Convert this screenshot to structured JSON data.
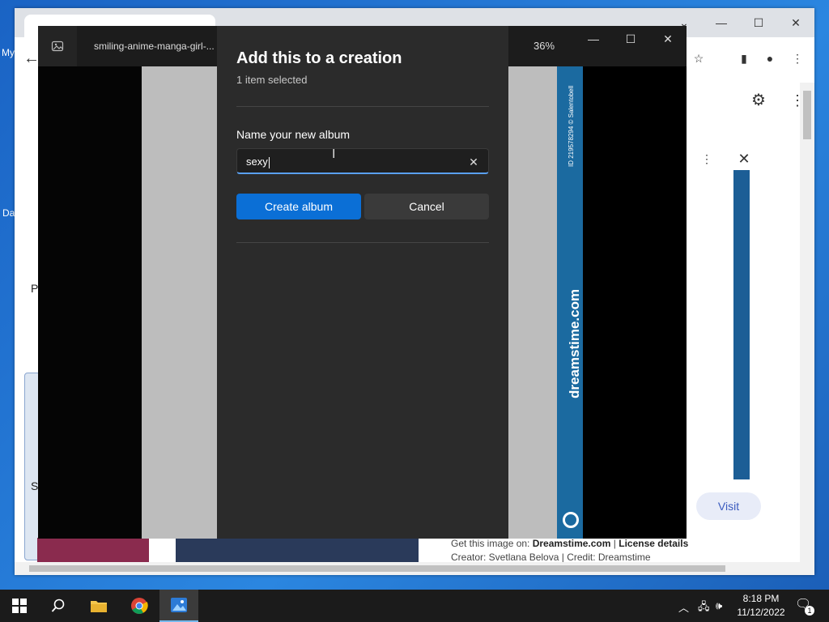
{
  "desktop": {
    "label_my": "My",
    "label_da": "Da"
  },
  "browser": {
    "left_text_p": "P",
    "left_text_s": "S",
    "credit_line1_prefix": "Get this image on: ",
    "credit_site": "Dreamstime.com",
    "credit_sep": " | ",
    "credit_license": "License details",
    "credit_line2": "Creator: Svetlana Belova | Credit: Dreamstime",
    "visit_label": "Visit"
  },
  "photos_app": {
    "file_title": "smiling-anime-manga-girl-...",
    "zoom_level": "36%",
    "strip_text": "dreamstime.com",
    "strip_id": "ID 219578294 © Salentobell"
  },
  "dialog": {
    "title": "Add this to a creation",
    "subtitle": "1 item selected",
    "name_label": "Name your new album",
    "name_value": "sexy",
    "create_label": "Create album",
    "cancel_label": "Cancel"
  },
  "taskbar": {
    "time": "8:18 PM",
    "date": "11/12/2022",
    "notification_count": "1"
  },
  "colors": {
    "accent": "#0b6fd6",
    "dialog_bg": "#2b2b2b",
    "taskbar_bg": "#1b1b1b"
  }
}
